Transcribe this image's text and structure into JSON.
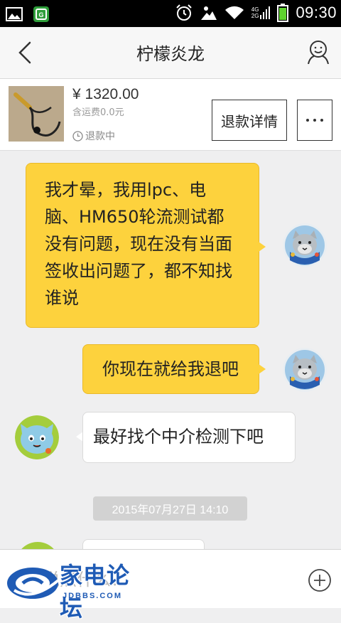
{
  "status_bar": {
    "time": "09:30",
    "network_4g": "4G",
    "network_2g": "2G",
    "icons": [
      "gallery-icon",
      "app-notification-icon",
      "alarm-icon",
      "weather-icon",
      "wifi-icon",
      "signal-icon",
      "battery-icon"
    ]
  },
  "header": {
    "title": "柠檬炎龙"
  },
  "product": {
    "price": "¥ 1320.00",
    "shipping": "含运费0.0元",
    "status": "退款中",
    "refund_button": "退款详情"
  },
  "messages": [
    {
      "sender": "me",
      "text": "我才晕，我用lpc、电脑、HM650轮流测试都没有问题，现在没有当面签收出问题了，都不知找谁说"
    },
    {
      "sender": "me",
      "text": "你现在就给我退吧"
    },
    {
      "sender": "other",
      "text": "最好找个中介检测下吧"
    }
  ],
  "timestamp": "2015年07月27日 14:10",
  "input": {
    "placeholder": "要说点什么？"
  },
  "watermark": {
    "text": "家电论坛",
    "url": "JDBBS.COM"
  },
  "colors": {
    "my_bubble": "#fdd23d",
    "other_bubble": "#ffffff",
    "background": "#efeff0",
    "watermark": "#1f5bb5"
  }
}
